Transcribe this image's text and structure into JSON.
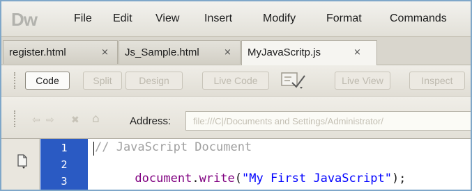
{
  "app": {
    "logo": "Dw"
  },
  "menu": {
    "items": [
      "File",
      "Edit",
      "View",
      "Insert",
      "Modify",
      "Format",
      "Commands"
    ]
  },
  "tabs": [
    {
      "label": "register.html",
      "close": "×"
    },
    {
      "label": "Js_Sample.html",
      "close": "×"
    },
    {
      "label": "MyJavaScritp.js",
      "close": "×",
      "active": true
    }
  ],
  "toolbar": {
    "code_label": "Code",
    "split_label": "Split",
    "design_label": "Design",
    "live_code_label": "Live Code",
    "live_view_label": "Live View",
    "inspect_label": "Inspect",
    "view_options_icon": "view-options-icon"
  },
  "address_bar": {
    "label": "Address:",
    "value": "file:///C|/Documents and Settings/Administrator/"
  },
  "editor": {
    "line_numbers": [
      "1",
      "2",
      "3"
    ],
    "lines": [
      {
        "kind": "comment",
        "text": "// JavaScript Document"
      },
      {
        "kind": "code",
        "object": "document",
        "dot": ".",
        "method": "write",
        "open": "(",
        "string": "\"My First JavaScript\"",
        "close": ");"
      },
      {
        "kind": "empty",
        "text": ""
      }
    ]
  },
  "colors": {
    "gutter": "#2a5ac3",
    "code_keyword": "#800080",
    "code_string": "#0000ff",
    "code_comment": "#a0a0a0"
  }
}
